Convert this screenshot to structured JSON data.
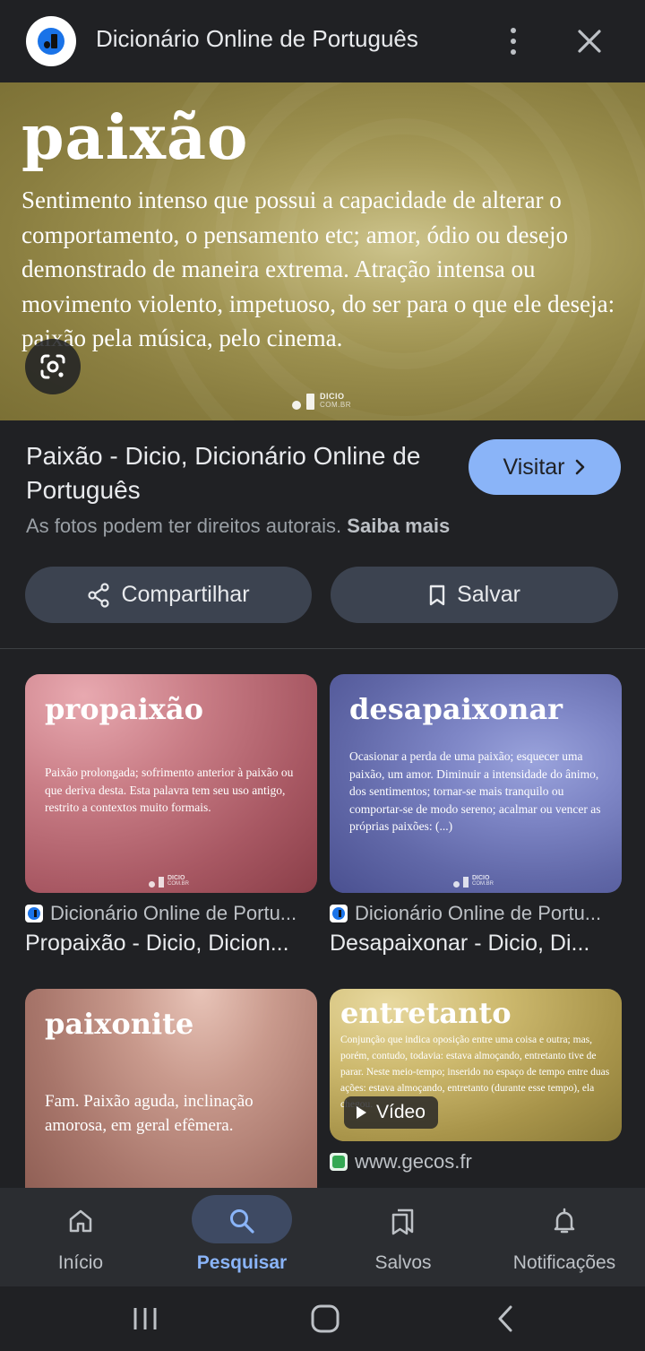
{
  "header": {
    "title": "Dicionário Online de Português",
    "logo_icon": "dicio-logo-icon",
    "menu_icon": "more-vert-icon",
    "close_icon": "close-icon"
  },
  "hero": {
    "word": "paixão",
    "definition": "Sentimento intenso que possui a capacidade de alterar o comportamento, o pensamento etc; amor, ódio ou desejo demonstrado de maneira extrema. Atração intensa ou movimento violento, impetuoso, do ser para o que ele deseja: paixão pela música, pelo cinema.",
    "watermark": "DICIO",
    "watermark_sub": "COM.BR",
    "lens_icon": "google-lens-icon"
  },
  "result": {
    "title": "Paixão - Dicio, Dicionário Online de Português",
    "visit_label": "Visitar",
    "copyright_text": "As fotos podem ter direitos autorais.",
    "learn_more": "Saiba mais",
    "share_label": "Compartilhar",
    "save_label": "Salvar"
  },
  "related": [
    {
      "word": "propaixão",
      "definition": "Paixão prolongada; sofrimento anterior à paixão ou que deriva desta. Esta palavra tem seu uso antigo, restrito a contextos muito formais.",
      "source": "Dicionário Online de Portu...",
      "title": "Propaixão - Dicio, Dicion..."
    },
    {
      "word": "desapaixonar",
      "definition": "Ocasionar a perda de uma paixão; esquecer uma paixão, um amor. Diminuir a intensidade do ânimo, dos sentimentos; tornar-se mais tranquilo ou comportar-se de modo sereno; acalmar ou vencer as próprias paixões: (...)",
      "source": "Dicionário Online de Portu...",
      "title": "Desapaixonar - Dicio, Di..."
    },
    {
      "word": "paixonite",
      "definition": "Fam. Paixão aguda, inclinação amorosa, em geral efêmera."
    },
    {
      "word": "entretanto",
      "definition": "Conjunção que indica oposição entre uma coisa e outra; mas, porém, contudo, todavia: estava almoçando, entretanto tive de parar. Neste meio-tempo; inserido no espaço de tempo entre duas ações: estava almoçando, entretanto (durante esse tempo), ela chegou.",
      "badge": "Vídeo",
      "source": "www.gecos.fr"
    }
  ],
  "bottom_nav": [
    {
      "label": "Início",
      "icon": "home-icon"
    },
    {
      "label": "Pesquisar",
      "icon": "search-icon"
    },
    {
      "label": "Salvos",
      "icon": "bookmarks-icon"
    },
    {
      "label": "Notificações",
      "icon": "bell-icon"
    }
  ],
  "colors": {
    "background": "#202124",
    "accent": "#8ab4f8",
    "button_bg": "#3c4350"
  }
}
